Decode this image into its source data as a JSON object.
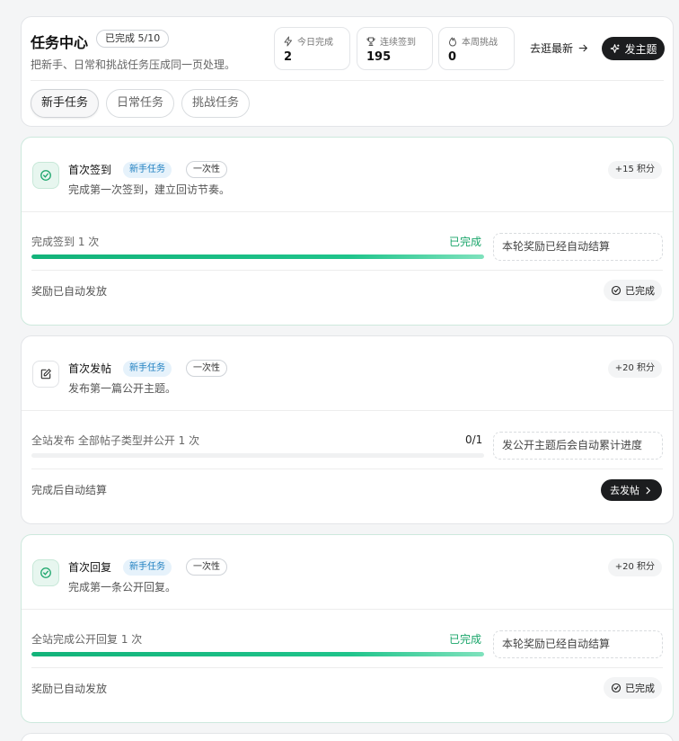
{
  "header": {
    "title": "任务中心",
    "done_summary": "已完成 5/10",
    "subtitle": "把新手、日常和挑战任务压成同一页处理。",
    "stats": [
      {
        "label": "今日完成",
        "value": "2",
        "icon": "bolt-icon"
      },
      {
        "label": "连续签到",
        "value": "195",
        "icon": "trophy-icon"
      },
      {
        "label": "本周挑战",
        "value": "0",
        "icon": "flame-icon"
      }
    ],
    "browse_label": "去逛最新",
    "post_label": "发主题",
    "tabs": [
      "新手任务",
      "日常任务",
      "挑战任务"
    ],
    "active_tab": "新手任务"
  },
  "tasks": [
    {
      "name": "首次签到",
      "tag": "新手任务",
      "type": "一次性",
      "desc": "完成第一次签到，建立回访节奏。",
      "points": "+15 积分",
      "progress_label": "完成签到 1 次",
      "progress_status": "已完成",
      "progress": 1.0,
      "note": "本轮奖励已经自动结算",
      "footer": "奖励已自动发放",
      "badge": "已完成",
      "completed": true,
      "icon": "check-circle-icon"
    },
    {
      "name": "首次发帖",
      "tag": "新手任务",
      "type": "一次性",
      "desc": "发布第一篇公开主题。",
      "points": "+20 积分",
      "progress_label": "全站发布 全部帖子类型并公开 1 次",
      "progress_count": "0/1",
      "progress": 0.0,
      "note": "发公开主题后会自动累计进度",
      "footer": "完成后自动结算",
      "action": "去发帖",
      "completed": false,
      "icon": "edit-icon"
    },
    {
      "name": "首次回复",
      "tag": "新手任务",
      "type": "一次性",
      "desc": "完成第一条公开回复。",
      "points": "+20 积分",
      "progress_label": "全站完成公开回复 1 次",
      "progress_status": "已完成",
      "progress": 1.0,
      "note": "本轮奖励已经自动结算",
      "footer": "奖励已自动发放",
      "badge": "已完成",
      "completed": true,
      "icon": "check-circle-icon"
    }
  ],
  "colors": {
    "accent_green": "#19a56a",
    "tag_blue": "#1e7fc0",
    "dark_button": "#1c1d1f"
  }
}
